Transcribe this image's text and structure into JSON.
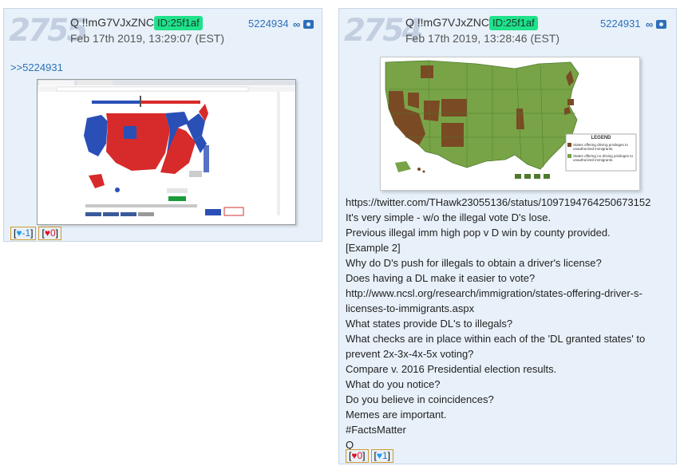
{
  "posts": [
    {
      "number": "2755",
      "author": "Q !!mG7VJxZNCI",
      "id_badge": "ID:25f1af",
      "date": "Feb 17th 2019, 13:29:07 (EST)",
      "post_no": "5224934",
      "reply_link": ">>5224931",
      "reactions": [
        {
          "icon": "twitter-icon",
          "value": "-1"
        },
        {
          "icon": "heart-icon",
          "value": "0"
        }
      ]
    },
    {
      "number": "2754",
      "author": "Q !!mG7VJxZNCI",
      "id_badge": "ID:25f1af",
      "date": "Feb 17th 2019, 13:28:46 (EST)",
      "post_no": "5224931",
      "map_legend": {
        "title": "LEGEND",
        "items": [
          {
            "label": "States offering driving privileges to unauthorized immigrants.",
            "color": "#7a4a24"
          },
          {
            "label": "States offering no driving privileges to unauthorized immigrants.",
            "color": "#78a447"
          }
        ]
      },
      "body": [
        "https://twitter.com/THawk23055136/status/1097194764250673152",
        "It's very simple - w/o the illegal vote D's lose.",
        "Previous illegal imm high pop v D win by county provided.",
        "[Example 2]",
        "Why do D's push for illegals to obtain a driver's license?",
        "Does having a DL make it easier to vote?",
        "http://www.ncsl.org/research/immigration/states-offering-driver-s-",
        "licenses-to-immigrants.aspx",
        "What states provide DL's to illegals?",
        "What checks are in place within each of the 'DL granted states' to",
        "prevent 2x-3x-4x-5x voting?",
        "Compare v. 2016 Presidential election results.",
        "What do you notice?",
        "Do you believe in coincidences?",
        "Memes are important.",
        "#FactsMatter",
        "Q"
      ],
      "reactions": [
        {
          "icon": "heart-icon",
          "value": "0"
        },
        {
          "icon": "twitter-icon",
          "value": "1"
        }
      ]
    }
  ],
  "colors": {
    "badge": "#1fe28b",
    "link": "#2d6fb8",
    "post_bg": "#e8f1fa"
  }
}
